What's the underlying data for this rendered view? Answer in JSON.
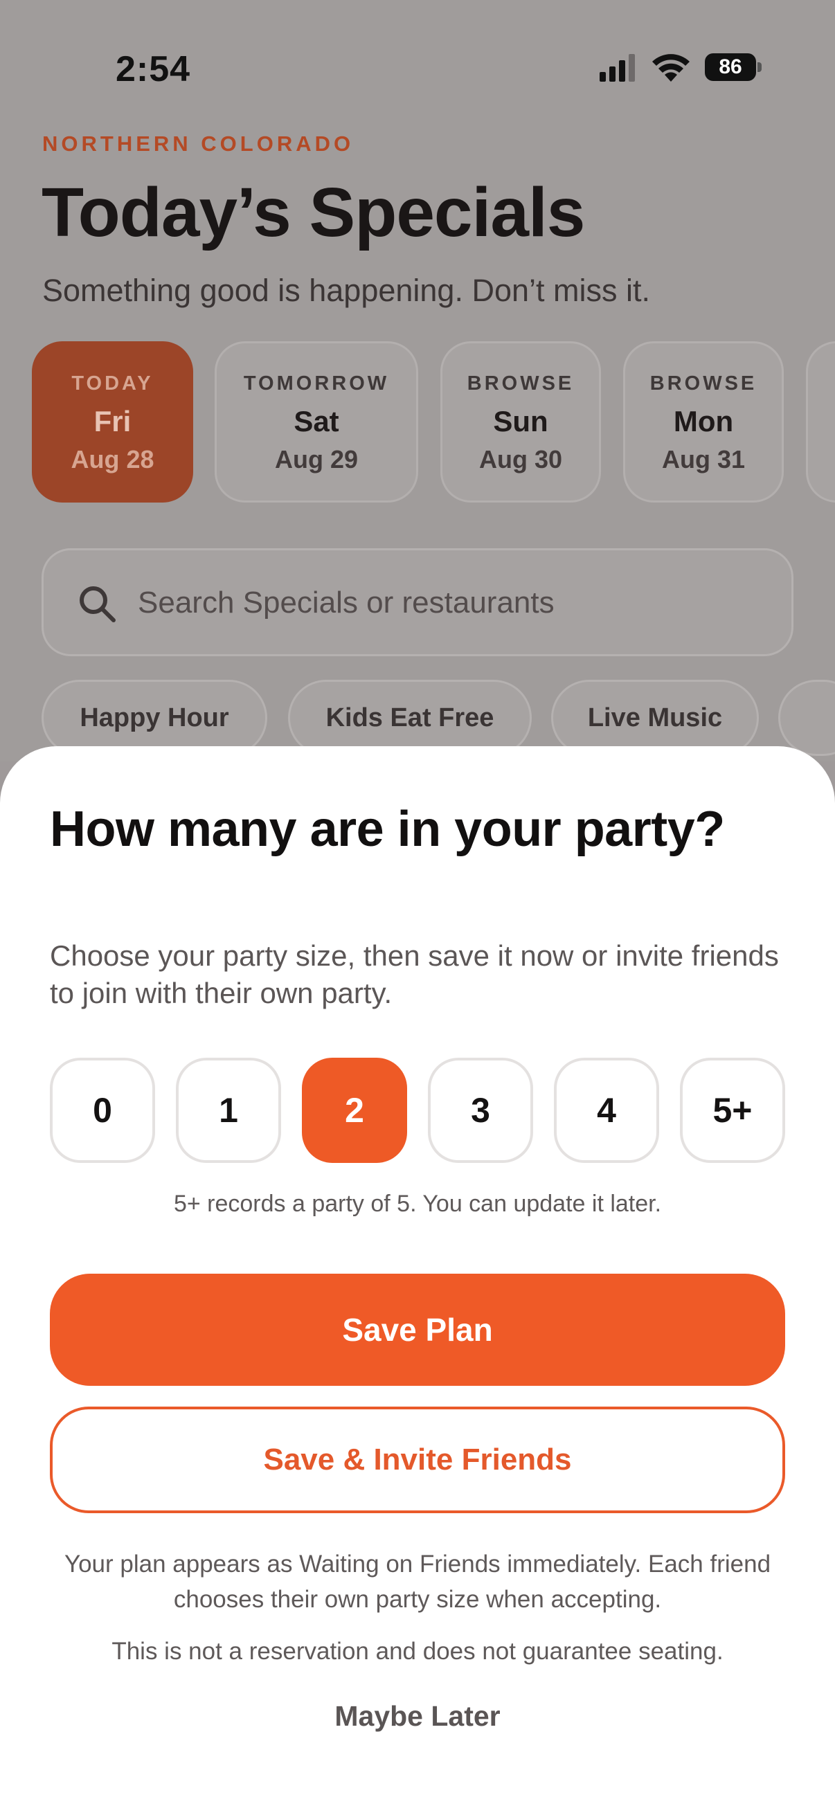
{
  "status": {
    "time": "2:54",
    "battery": "86",
    "icons": [
      "signal-icon",
      "wifi-icon",
      "battery-icon"
    ]
  },
  "header": {
    "region": "NORTHERN COLORADO",
    "title": "Today’s Specials",
    "subtitle": "Something good is happening. Don’t miss it."
  },
  "days": [
    {
      "kind": "TODAY",
      "name": "Fri",
      "date": "Aug 28",
      "active": true
    },
    {
      "kind": "TOMORROW",
      "name": "Sat",
      "date": "Aug 29",
      "active": false
    },
    {
      "kind": "BROWSE",
      "name": "Sun",
      "date": "Aug 30",
      "active": false
    },
    {
      "kind": "BROWSE",
      "name": "Mon",
      "date": "Aug 31",
      "active": false
    }
  ],
  "search": {
    "placeholder": "Search Specials or restaurants",
    "icon": "search-icon"
  },
  "filters": [
    "Happy Hour",
    "Kids Eat Free",
    "Live Music"
  ],
  "sheet": {
    "title": "How many are in your party?",
    "description": "Choose your party size, then save it now or invite friends to join with their own party.",
    "sizes": [
      "0",
      "1",
      "2",
      "3",
      "4",
      "5+"
    ],
    "selected_size": "2",
    "size_hint": "5+ records a party of 5. You can update it later.",
    "save_label": "Save Plan",
    "invite_label": "Save & Invite Friends",
    "note": "Your plan appears as Waiting on Friends immediately. Each friend chooses their own party size when accepting.",
    "disclaimer": "This is not a reservation and does not guarantee seating.",
    "dismiss_label": "Maybe Later"
  },
  "colors": {
    "accent": "#EF5A27",
    "region_text": "#B44A25",
    "overlay": "#A09C9B"
  }
}
